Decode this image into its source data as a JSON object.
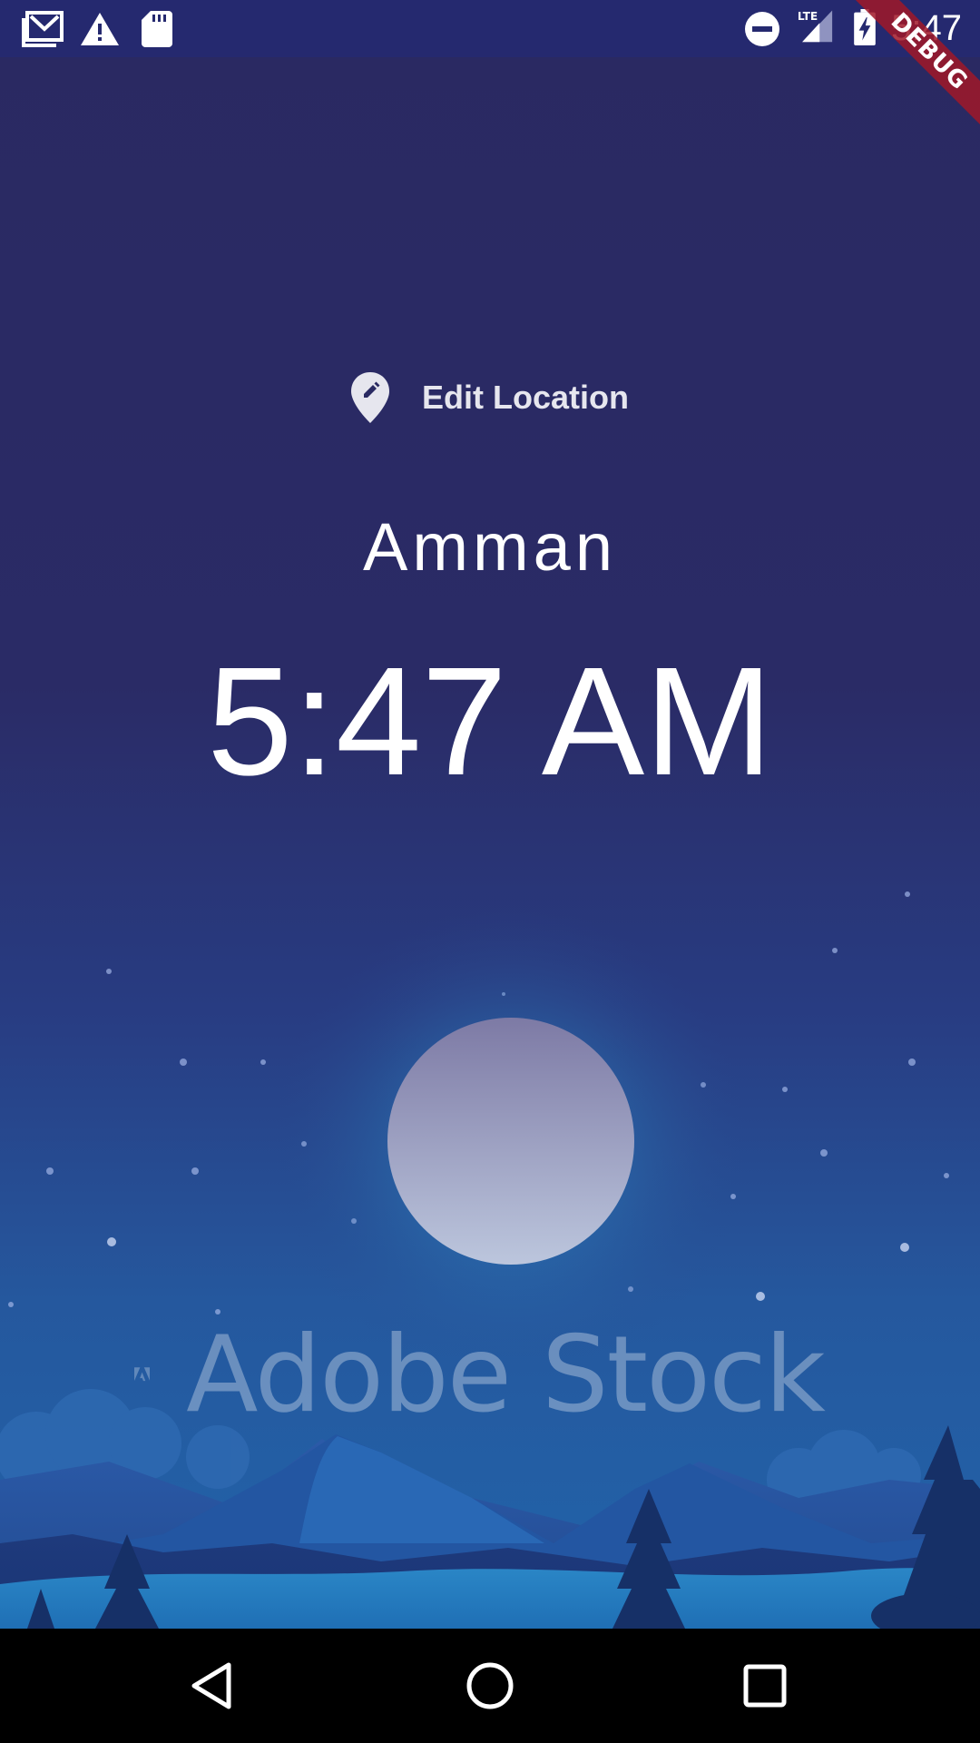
{
  "status_bar": {
    "time": "5:47",
    "network": "LTE",
    "icons": [
      "gmail-icon",
      "warning-icon",
      "sd-card-icon",
      "do-not-disturb-icon",
      "lte-signal-icon",
      "battery-charging-icon"
    ]
  },
  "debug_banner": {
    "label": "DEBUG",
    "color": "#a01828"
  },
  "main": {
    "edit_location_label": "Edit Location",
    "edit_location_icon": "edit-location-icon",
    "city": "Amman",
    "time": "5:47 AM"
  },
  "background": {
    "scene": "night-sky-moon-mountains",
    "watermark_text": "Adobe Stock",
    "sky_color": "#2a2a62",
    "moon_color": "#b7bdd9"
  },
  "nav_bar": {
    "buttons": [
      "back-icon",
      "home-icon",
      "recents-icon"
    ]
  }
}
